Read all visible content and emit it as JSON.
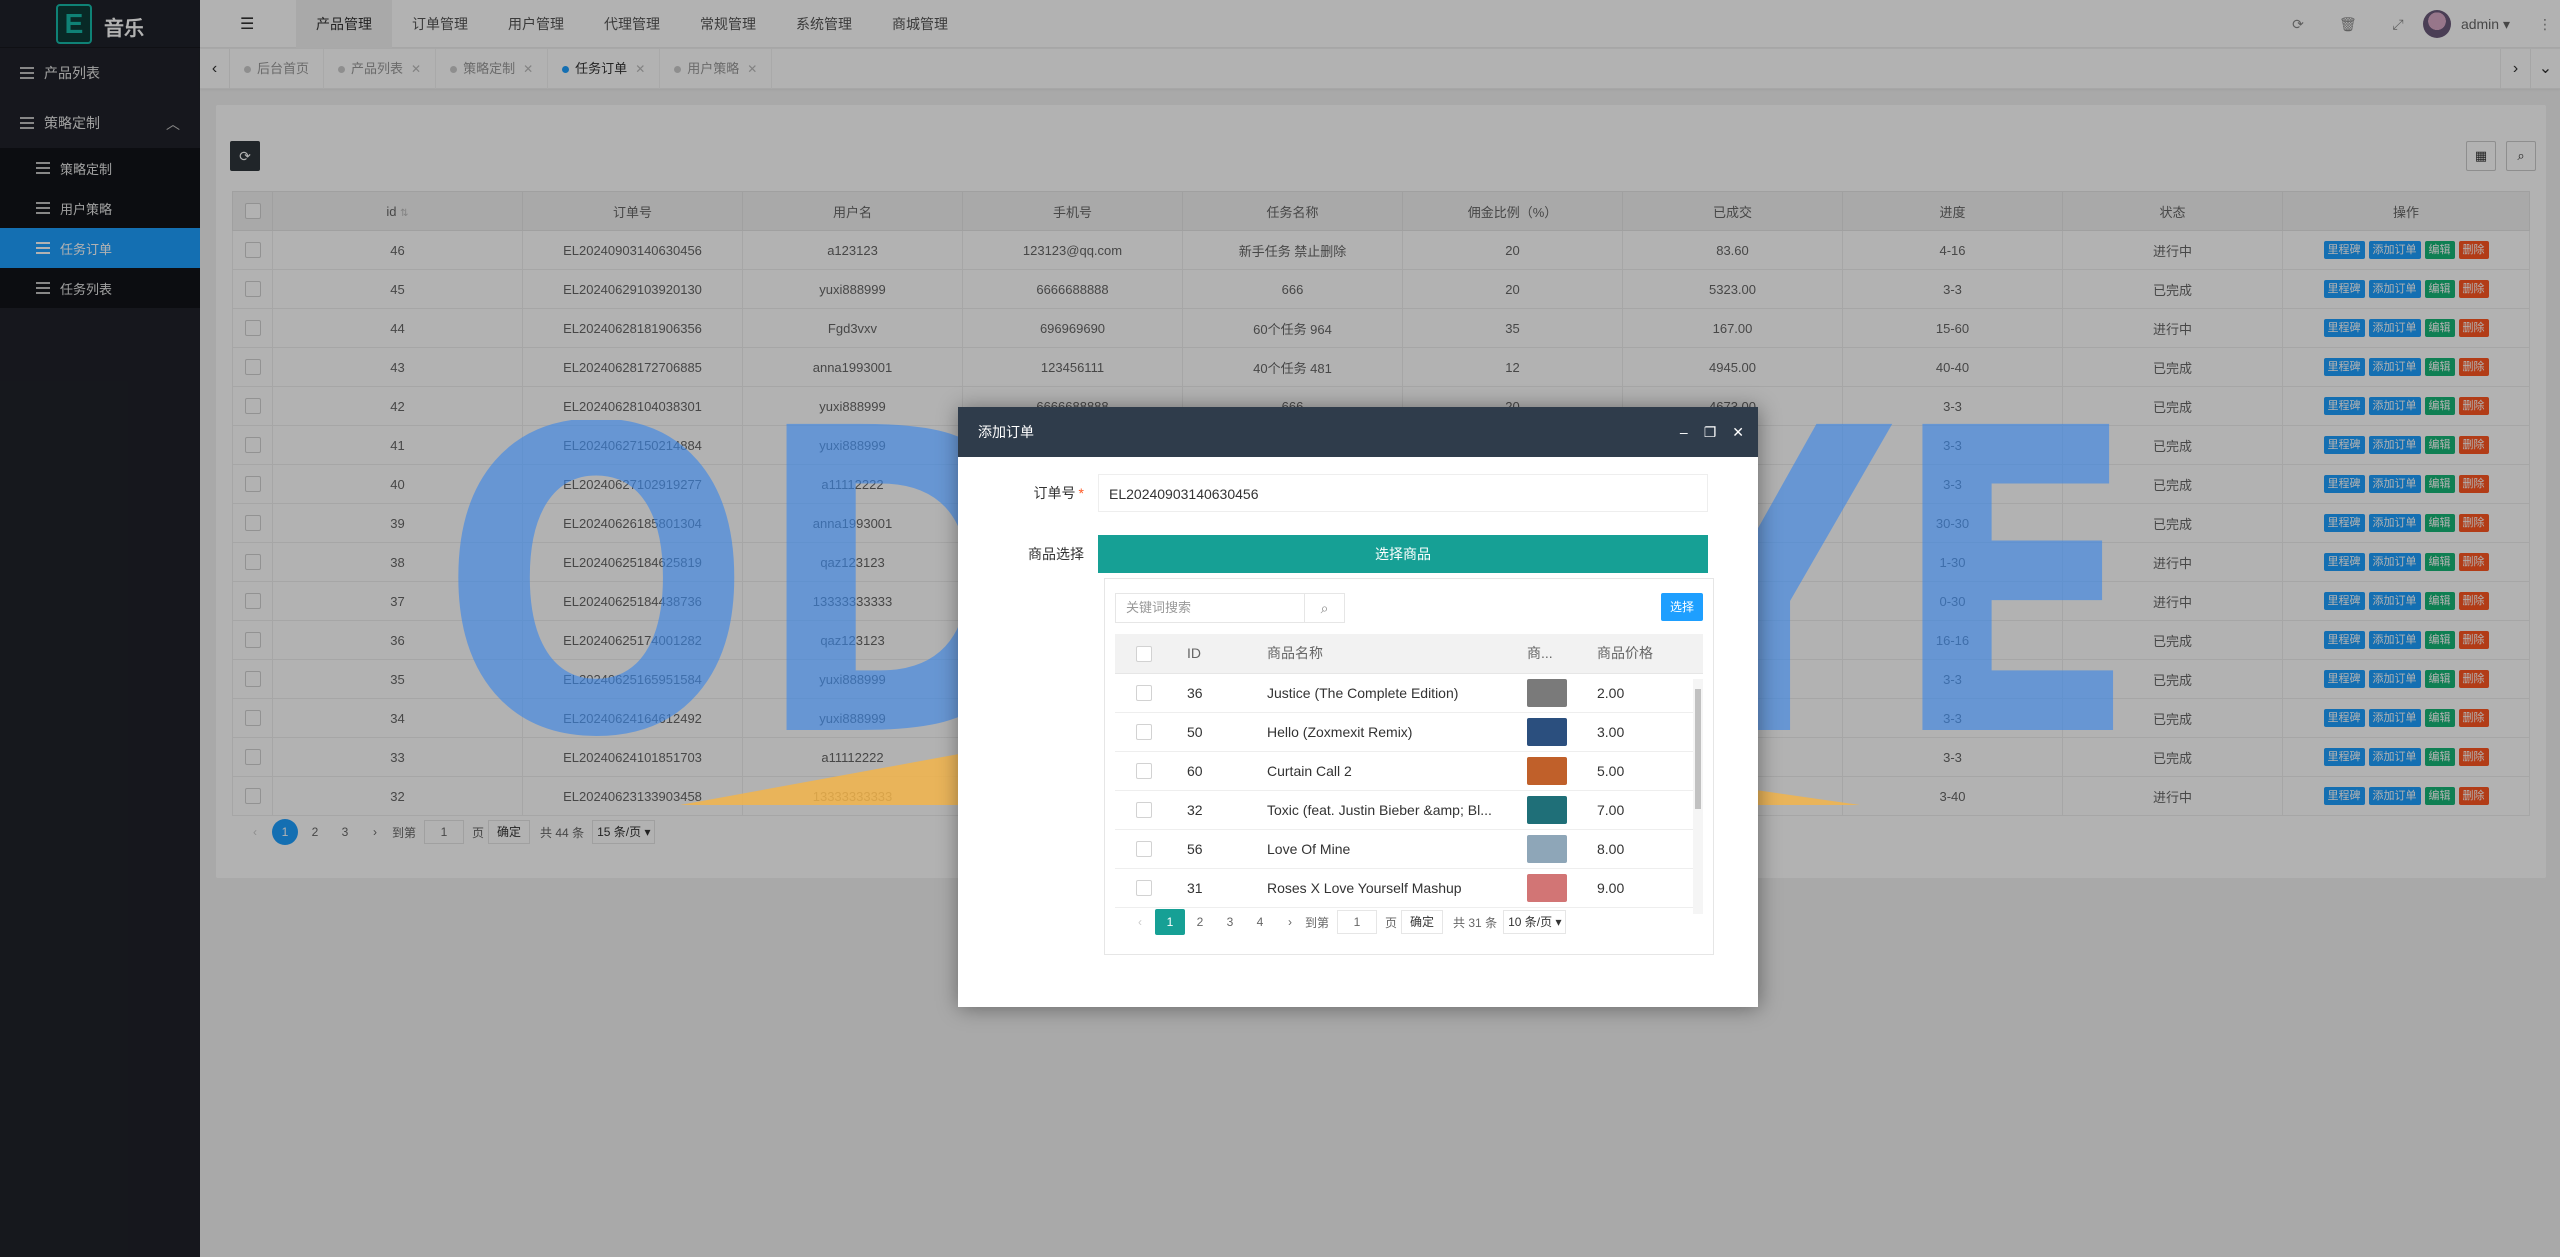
{
  "app": {
    "logo_letter": "E",
    "title": "音乐"
  },
  "sidebar": {
    "items": [
      {
        "label": "产品列表"
      },
      {
        "label": "策略定制",
        "expanded": true
      }
    ],
    "subitems": [
      {
        "label": "策略定制",
        "active": false
      },
      {
        "label": "用户策略",
        "active": false
      },
      {
        "label": "任务订单",
        "active": true
      },
      {
        "label": "任务列表",
        "active": false
      }
    ]
  },
  "header": {
    "menu": [
      "产品管理",
      "订单管理",
      "用户管理",
      "代理管理",
      "常规管理",
      "系统管理",
      "商城管理"
    ],
    "active_menu": "产品管理",
    "user": "admin"
  },
  "tabs": [
    {
      "label": "后台首页",
      "closable": false,
      "active": false
    },
    {
      "label": "产品列表",
      "closable": true,
      "active": false
    },
    {
      "label": "策略定制",
      "closable": true,
      "active": false
    },
    {
      "label": "任务订单",
      "closable": true,
      "active": true
    },
    {
      "label": "用户策略",
      "closable": true,
      "active": false
    }
  ],
  "table": {
    "headers": [
      "id",
      "订单号",
      "用户名",
      "手机号",
      "任务名称",
      "佣金比例（%）",
      "已成交",
      "进度",
      "状态",
      "操作"
    ],
    "rows": [
      [
        "46",
        "EL20240903140630456",
        "a123123",
        "123123@qq.com",
        "新手任务 禁止删除",
        "20",
        "83.60",
        "4-16",
        "进行中"
      ],
      [
        "45",
        "EL20240629103920130",
        "yuxi888999",
        "6666688888",
        "666",
        "20",
        "5323.00",
        "3-3",
        "已完成"
      ],
      [
        "44",
        "EL20240628181906356",
        "Fgd3vxv",
        "696969690",
        "60个任务 964",
        "35",
        "167.00",
        "15-60",
        "进行中"
      ],
      [
        "43",
        "EL20240628172706885",
        "anna1993001",
        "123456111",
        "40个任务 481",
        "12",
        "4945.00",
        "40-40",
        "已完成"
      ],
      [
        "42",
        "EL20240628104038301",
        "yuxi888999",
        "6666688888",
        "666",
        "20",
        "4673.00",
        "3-3",
        "已完成"
      ],
      [
        "41",
        "EL20240627150214884",
        "yuxi888999",
        "",
        "",
        "",
        "",
        "3-3",
        "已完成"
      ],
      [
        "40",
        "EL20240627102919277",
        "a11112222",
        "",
        "",
        "",
        "",
        "3-3",
        "已完成"
      ],
      [
        "39",
        "EL20240626185801304",
        "anna1993001",
        "",
        "",
        "",
        "",
        "30-30",
        "已完成"
      ],
      [
        "38",
        "EL20240625184625819",
        "qaz123123",
        "",
        "",
        "",
        "",
        "1-30",
        "进行中"
      ],
      [
        "37",
        "EL20240625184438736",
        "13333333333",
        "",
        "",
        "",
        "",
        "0-30",
        "进行中"
      ],
      [
        "36",
        "EL20240625174001282",
        "qaz123123",
        "",
        "",
        "",
        "",
        "16-16",
        "已完成"
      ],
      [
        "35",
        "EL20240625165951584",
        "yuxi888999",
        "",
        "",
        "",
        "",
        "3-3",
        "已完成"
      ],
      [
        "34",
        "EL20240624164612492",
        "yuxi888999",
        "",
        "",
        "",
        "",
        "3-3",
        "已完成"
      ],
      [
        "33",
        "EL20240624101851703",
        "a11112222",
        "",
        "",
        "",
        "",
        "3-3",
        "已完成"
      ],
      [
        "32",
        "EL20240623133903458",
        "13333333333",
        "",
        "",
        "",
        "",
        "3-40",
        "进行中"
      ]
    ],
    "ops": [
      "里程碑",
      "添加订单",
      "编辑",
      "删除"
    ]
  },
  "pager": {
    "pages": [
      "1",
      "2",
      "3"
    ],
    "goto_label": "到第",
    "goto_value": "1",
    "page_unit": "页",
    "ok": "确定",
    "total": "共 44 条",
    "per_page": "15 条/页"
  },
  "modal": {
    "title": "添加订单",
    "order_label": "订单号",
    "order_value": "EL20240903140630456",
    "product_label": "商品选择",
    "pick_button": "选择商品",
    "search_placeholder": "关键词搜索",
    "choose": "选择",
    "headers": [
      "ID",
      "商品名称",
      "商...",
      "商品价格"
    ],
    "products": [
      {
        "id": "36",
        "name": "Justice (The Complete Edition)",
        "price": "2.00",
        "thumb": "#7a7a7a"
      },
      {
        "id": "50",
        "name": "Hello (Zoxmexit Remix)",
        "price": "3.00",
        "thumb": "#2b4f7e"
      },
      {
        "id": "60",
        "name": "Curtain Call 2",
        "price": "5.00",
        "thumb": "#c0602a"
      },
      {
        "id": "32",
        "name": "Toxic (feat. Justin Bieber &amp; Bl...",
        "price": "7.00",
        "thumb": "#1f6f78"
      },
      {
        "id": "56",
        "name": "Love Of Mine",
        "price": "8.00",
        "thumb": "#8ea6b8"
      },
      {
        "id": "31",
        "name": "Roses X Love Yourself Mashup",
        "price": "9.00",
        "thumb": "#d27575"
      }
    ],
    "pager": {
      "pages": [
        "1",
        "2",
        "3",
        "4"
      ],
      "goto_label": "到第",
      "goto_value": "1",
      "page_unit": "页",
      "ok": "确定",
      "total": "共 31 条",
      "per_page": "10 条/页"
    }
  },
  "watermark": {
    "text": "ODOEYE"
  }
}
